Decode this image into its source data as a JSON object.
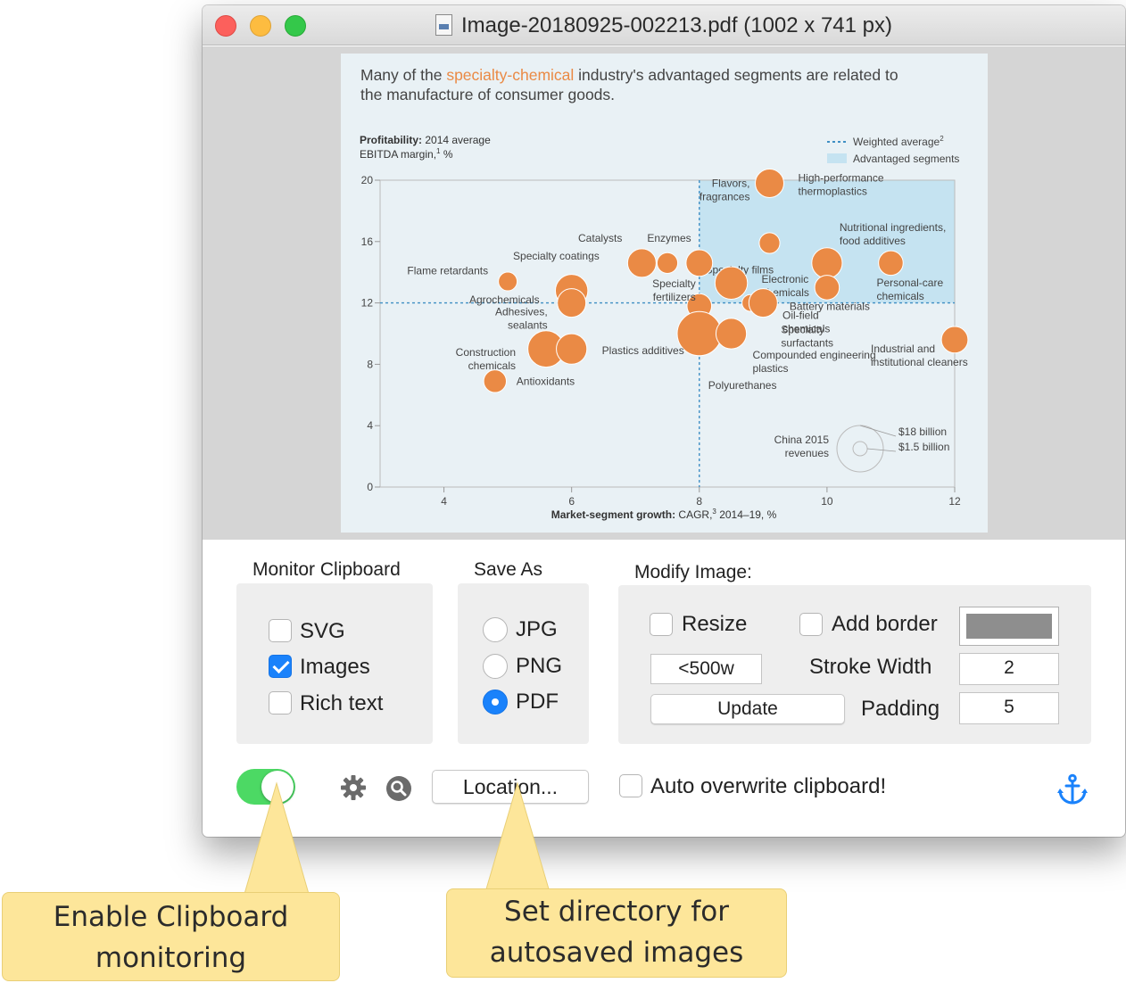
{
  "window": {
    "title": "Image-20180925-002213.pdf (1002 x 741 px)"
  },
  "figure": {
    "headline_pre": "Many of the ",
    "headline_highlight": "specialty-chemical",
    "headline_post_line1": " industry's advantaged segments are related to",
    "headline_line2": "the manufacture of consumer goods.",
    "ylabel_bold": "Profitability:",
    "ylabel_rest": " 2014 average",
    "ylabel_line2": "EBITDA margin,",
    "ylabel_line2_sup": "1",
    "ylabel_line2_end": " %",
    "legend_weighted": "Weighted average",
    "legend_weighted_sup": "2",
    "legend_advantaged": "Advantaged segments",
    "xlabel_bold": "Market-segment growth:",
    "xlabel_rest": " CAGR,",
    "xlabel_sup": "3",
    "xlabel_end": " 2014–19, %",
    "size_key_label1": "China 2015",
    "size_key_label2": "revenues",
    "size_key_big": "$18 billion",
    "size_key_small": "$1.5 billion",
    "colors": {
      "bubble": "#ea8a45",
      "highlight_text": "#ea8a45",
      "advantaged_area": "#c5e3f1",
      "reference_line": "#3f8fc4",
      "background": "#e9f1f5"
    }
  },
  "chart_data": {
    "type": "scatter",
    "xlabel": "Market-segment growth: CAGR, 2014–19, %",
    "ylabel": "Profitability: 2014 average EBITDA margin, %",
    "xlim": [
      3,
      12
    ],
    "ylim": [
      0,
      20
    ],
    "x_ticks": [
      "4",
      "6",
      "8",
      "10",
      "12"
    ],
    "y_ticks": [
      "0",
      "4",
      "8",
      "12",
      "16",
      "20"
    ],
    "weighted_average": {
      "x": 8,
      "y": 12
    },
    "points": [
      {
        "label": "Flavors, fragrances",
        "x": 9.1,
        "y": 19.8,
        "size": 5
      },
      {
        "label": "High-performance thermoplastics",
        "x": 9.1,
        "y": 19.8,
        "size": 5
      },
      {
        "label": "Specialty films",
        "x": 9.1,
        "y": 15.9,
        "size": 3
      },
      {
        "label": "Catalysts",
        "x": 7.1,
        "y": 14.6,
        "size": 5
      },
      {
        "label": "Enzymes",
        "x": 7.5,
        "y": 14.6,
        "size": 3
      },
      {
        "label": "Specialty coatings",
        "x": 8.0,
        "y": 14.6,
        "size": 4.5
      },
      {
        "label": "Electronic chemicals",
        "x": 8.5,
        "y": 13.3,
        "size": 6
      },
      {
        "label": "Nutritional ingredients, food additives",
        "x": 10.0,
        "y": 14.6,
        "size": 5.5
      },
      {
        "label": "Personal-care chemicals",
        "x": 11.0,
        "y": 14.6,
        "size": 4
      },
      {
        "label": "Battery materials",
        "x": 10.0,
        "y": 13.0,
        "size": 4
      },
      {
        "label": "Flame retardants",
        "x": 5.0,
        "y": 13.4,
        "size": 2.5
      },
      {
        "label": "Agrochemicals",
        "x": 6.0,
        "y": 12.8,
        "size": 6
      },
      {
        "label": "Adhesives, sealants",
        "x": 6.0,
        "y": 12.0,
        "size": 5
      },
      {
        "label": "Specialty fertilizers",
        "x": 8.0,
        "y": 11.8,
        "size": 4
      },
      {
        "label": "Oil-field chemicals",
        "x": 8.8,
        "y": 12.0,
        "size": 2
      },
      {
        "label": "Specialty surfactants",
        "x": 9.0,
        "y": 12.0,
        "size": 5
      },
      {
        "label": "Polyurethanes",
        "x": 8.0,
        "y": 10.0,
        "size": 9
      },
      {
        "label": "Compounded engineering plastics",
        "x": 8.5,
        "y": 10.0,
        "size": 5.5
      },
      {
        "label": "Industrial and institutional cleaners",
        "x": 12.0,
        "y": 9.6,
        "size": 4.5
      },
      {
        "label": "Construction chemicals",
        "x": 5.6,
        "y": 9.0,
        "size": 7
      },
      {
        "label": "Plastics additives",
        "x": 6.0,
        "y": 9.0,
        "size": 5.5
      },
      {
        "label": "Antioxidants",
        "x": 4.8,
        "y": 6.9,
        "size": 3.5
      }
    ]
  },
  "monitor": {
    "heading": "Monitor Clipboard",
    "options": [
      {
        "label": "SVG",
        "checked": false
      },
      {
        "label": "Images",
        "checked": true
      },
      {
        "label": "Rich text",
        "checked": false
      }
    ]
  },
  "save_as": {
    "heading": "Save As",
    "options": [
      {
        "label": "JPG",
        "selected": false
      },
      {
        "label": "PNG",
        "selected": false
      },
      {
        "label": "PDF",
        "selected": true
      }
    ]
  },
  "modify": {
    "heading": "Modify Image:",
    "resize_label": "Resize",
    "resize_checked": false,
    "add_border_label": "Add border",
    "add_border_checked": false,
    "border_color": "#8e8e8e",
    "resize_value": "<500w",
    "stroke_width_label": "Stroke Width",
    "stroke_width_value": "2",
    "update_button": "Update",
    "padding_label": "Padding",
    "padding_value": "5"
  },
  "footer": {
    "monitoring_enabled": true,
    "location_button": "Location...",
    "auto_overwrite_label": "Auto overwrite clipboard!",
    "auto_overwrite_checked": false,
    "icons": [
      "gear-icon",
      "search-icon",
      "anchor-icon"
    ],
    "toggle_color": "#4cd964",
    "accent": "#1a82fb"
  },
  "callouts": {
    "enable_line1": "Enable Clipboard",
    "enable_line2": "monitoring",
    "directory_line1": "Set directory for",
    "directory_line2": "autosaved images",
    "color": "#fde69a"
  }
}
